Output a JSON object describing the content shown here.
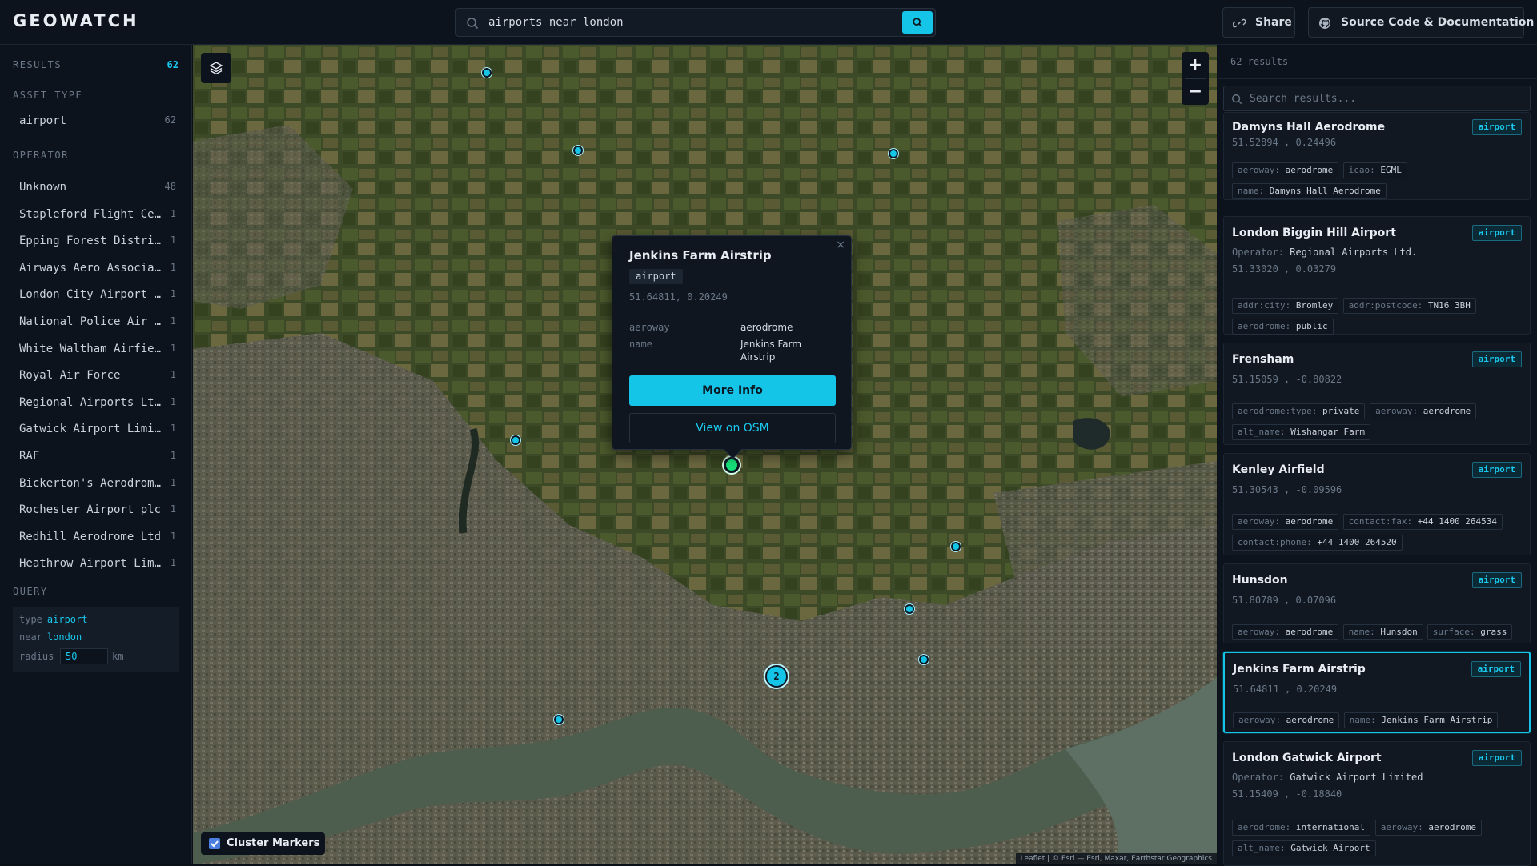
{
  "header": {
    "logo": "GEOWATCH",
    "search_value": "airports near london",
    "share_label": "Share",
    "source_label": "Source Code & Documentation"
  },
  "sidebar": {
    "results_label": "RESULTS",
    "results_count": "62",
    "asset_type_label": "ASSET TYPE",
    "asset_types": [
      {
        "name": "airport",
        "count": "62"
      }
    ],
    "operator_label": "OPERATOR",
    "operators": [
      {
        "name": "Unknown",
        "count": "48"
      },
      {
        "name": "Stapleford Flight Centre",
        "count": "1"
      },
      {
        "name": "Epping Forest District Council",
        "count": "1"
      },
      {
        "name": "Airways Aero Associations",
        "count": "1"
      },
      {
        "name": "London City Airport Limited",
        "count": "1"
      },
      {
        "name": "National Police Air Service",
        "count": "1"
      },
      {
        "name": "White Waltham Airfield Ltd",
        "count": "1"
      },
      {
        "name": "Royal Air Force",
        "count": "1"
      },
      {
        "name": "Regional Airports Ltd.",
        "count": "1"
      },
      {
        "name": "Gatwick Airport Limited",
        "count": "1"
      },
      {
        "name": "RAF",
        "count": "1"
      },
      {
        "name": "Bickerton's Aerodromes Ltd",
        "count": "1"
      },
      {
        "name": "Rochester Airport plc",
        "count": "1"
      },
      {
        "name": "Redhill Aerodrome Ltd",
        "count": "1"
      },
      {
        "name": "Heathrow Airport Limited",
        "count": "1"
      }
    ],
    "query_label": "QUERY",
    "query": {
      "type_key": "type",
      "type_val": "airport",
      "near_key": "near",
      "near_val": "london",
      "radius_key": "radius",
      "radius_val": "50",
      "radius_unit": "km"
    }
  },
  "map": {
    "cluster_count": "2",
    "zoom_in": "+",
    "zoom_out": "−",
    "cluster_toggle_label": "Cluster Markers",
    "attribution": "Leaflet | © Esri — Esri, Maxar, Earthstar Geographics",
    "popup": {
      "title": "Jenkins Farm Airstrip",
      "close": "×",
      "tag": "airport",
      "coords": "51.64811, 0.20249",
      "rows": [
        {
          "key": "aeroway",
          "value": "aerodrome"
        },
        {
          "key": "name",
          "value": "Jenkins Farm Airstrip"
        }
      ],
      "more_info": "More Info",
      "view_osm": "View on OSM"
    }
  },
  "results": {
    "count_label": "62 results",
    "search_placeholder": "Search results...",
    "badge": "airport",
    "cards": [
      {
        "title": "Damyns Hall Aerodrome",
        "coords": "51.52894 , 0.24496",
        "chips": [
          [
            "aeroway:",
            "aerodrome"
          ],
          [
            "icao:",
            "EGML"
          ],
          [
            "name:",
            "Damyns Hall Aerodrome"
          ]
        ]
      },
      {
        "title": "London Biggin Hill Airport",
        "operator_key": "Operator:",
        "operator": "Regional Airports Ltd.",
        "coords": "51.33020 , 0.03279",
        "chips": [
          [
            "addr:city:",
            "Bromley"
          ],
          [
            "addr:postcode:",
            "TN16 3BH"
          ],
          [
            "aerodrome:",
            "public"
          ]
        ]
      },
      {
        "title": "Frensham",
        "coords": "51.15059 , -0.80822",
        "chips": [
          [
            "aerodrome:type:",
            "private"
          ],
          [
            "aeroway:",
            "aerodrome"
          ],
          [
            "alt_name:",
            "Wishangar Farm"
          ]
        ]
      },
      {
        "title": "Kenley Airfield",
        "coords": "51.30543 , -0.09596",
        "chips": [
          [
            "aeroway:",
            "aerodrome"
          ],
          [
            "contact:fax:",
            "+44 1400 264534"
          ],
          [
            "contact:phone:",
            "+44 1400 264520"
          ]
        ]
      },
      {
        "title": "Hunsdon",
        "coords": "51.80789 , 0.07096",
        "chips": [
          [
            "aeroway:",
            "aerodrome"
          ],
          [
            "name:",
            "Hunsdon"
          ],
          [
            "surface:",
            "grass"
          ]
        ]
      },
      {
        "title": "Jenkins Farm Airstrip",
        "coords": "51.64811 , 0.20249",
        "chips": [
          [
            "aeroway:",
            "aerodrome"
          ],
          [
            "name:",
            "Jenkins Farm Airstrip"
          ]
        ]
      },
      {
        "title": "London Gatwick Airport",
        "operator_key": "Operator:",
        "operator": "Gatwick Airport Limited",
        "coords": "51.15409 , -0.18840",
        "chips": [
          [
            "aerodrome:",
            "international"
          ],
          [
            "aeroway:",
            "aerodrome"
          ],
          [
            "alt_name:",
            "Gatwick Airport"
          ]
        ]
      }
    ]
  },
  "colors": {
    "accent": "#14c5e8",
    "selected_marker": "#16e07a",
    "panel": "#0d131c"
  }
}
